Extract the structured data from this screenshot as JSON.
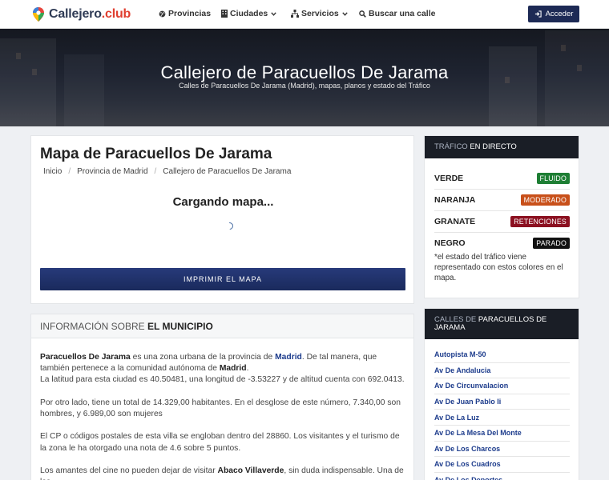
{
  "header": {
    "logo_main": "Callejero",
    "logo_suffix": ".club",
    "nav": [
      {
        "label": "Provincias",
        "icon": "globe-icon"
      },
      {
        "label": "Ciudades",
        "icon": "building-icon"
      },
      {
        "label": "Servicios",
        "icon": "sitemap-icon"
      },
      {
        "label": "Buscar una calle",
        "icon": "search-icon"
      }
    ],
    "login_label": "Acceder"
  },
  "hero": {
    "title": "Callejero de Paracuellos De Jarama",
    "subtitle": "Calles de Paracuellos De Jarama (Madrid), mapas, planos y estado del Tráfico"
  },
  "map_section": {
    "title": "Mapa de Paracuellos De Jarama",
    "breadcrumb": [
      "Inicio",
      "Provincia de Madrid",
      "Callejero de Paracuellos De Jarama"
    ],
    "loading_text": "Cargando mapa...",
    "print_label": "IMPRIMIR EL MAPA"
  },
  "info": {
    "heading_prefix": "INFORMACIÓN SOBRE",
    "heading_strong": "EL MUNICIPIO",
    "p1": {
      "town": "Paracuellos De Jarama",
      "t1": " es una zona urbana de la provincia de ",
      "province": "Madrid",
      "t2": ". De tal manera, que también pertenece a la comunidad autónoma de ",
      "region": "Madrid",
      "t3": ".",
      "line2": "La latitud para esta ciudad es 40.50481, una longitud de -3.53227 y de altitud cuenta con 692.0413."
    },
    "p2": "Por otro lado, tiene un total de 14.329,00 habitantes. En el desglose de este número, 7.340,00 son hombres, y 6.989,00 son mujeres",
    "p3": "El CP o códigos postales de esta villa se engloban dentro del 28860. Los visitantes y el turismo de la zona le ha otorgado una nota de 4.6 sobre 5 puntos.",
    "p4": {
      "t1": "Los amantes del cine no pueden dejar de visitar ",
      "place": "Abaco Villaverde",
      "t2": ", sin duda indispensable. Una de las"
    }
  },
  "traffic": {
    "head_prefix": "TRÁFICO",
    "head_strong": "EN DIRECTO",
    "rows": [
      {
        "label": "VERDE",
        "badge": "FLUIDO",
        "color": "#1e7e34"
      },
      {
        "label": "NARANJA",
        "badge": "MODERADO",
        "color": "#c8501a"
      },
      {
        "label": "GRANATE",
        "badge": "RETENCIONES",
        "color": "#8b1020"
      },
      {
        "label": "NEGRO",
        "badge": "PARADO",
        "color": "#111111"
      }
    ],
    "note": "*el estado del tráfico viene representado con estos colores en el mapa."
  },
  "streets": {
    "head_prefix": "CALLES DE",
    "head_strong": "PARACUELLOS DE JARAMA",
    "items": [
      "Autopista M-50",
      "Av De Andalucia",
      "Av De Circunvalacion",
      "Av De Juan Pablo Ii",
      "Av De La Luz",
      "Av De La Mesa Del Monte",
      "Av De Los Charcos",
      "Av De Los Cuadros",
      "Av De Los Deportes"
    ]
  }
}
